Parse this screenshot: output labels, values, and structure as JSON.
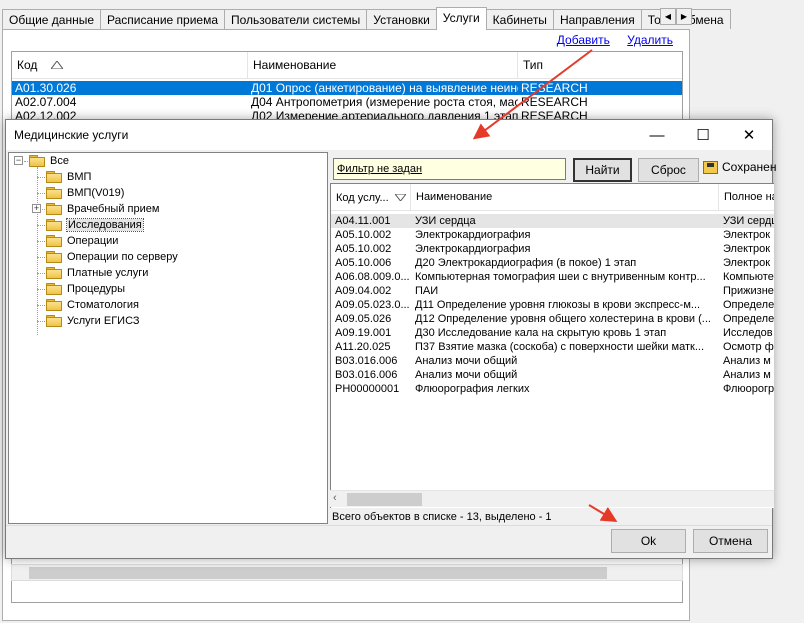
{
  "tabs": [
    {
      "label": "Общие данные",
      "active": false
    },
    {
      "label": "Расписание приема",
      "active": false
    },
    {
      "label": "Пользователи системы",
      "active": false
    },
    {
      "label": "Установки",
      "active": false
    },
    {
      "label": "Услуги",
      "active": true
    },
    {
      "label": "Кабинеты",
      "active": false
    },
    {
      "label": "Направления",
      "active": false
    },
    {
      "label": "Точки обмена",
      "active": false
    }
  ],
  "services_panel": {
    "add_link": "Добавить",
    "delete_link": "Удалить",
    "columns": {
      "code": "Код",
      "name": "Наименование",
      "type": "Тип"
    },
    "rows": [
      {
        "code": "A01.30.026",
        "name": "Д01 Опрос (анкетирование) на выявление неинф...",
        "type": "RESEARCH",
        "selected": true
      },
      {
        "code": "A02.07.004",
        "name": "Д04 Антропометрия (измерение роста стоя, мас...",
        "type": "RESEARCH",
        "selected": false
      },
      {
        "code": "A02.12.002",
        "name": "Д02 Измерение артериального давления 1 этап",
        "type": "RESEARCH",
        "selected": false
      }
    ]
  },
  "dialog": {
    "title": "Медицинские услуги",
    "window_buttons": {
      "minimize": "—",
      "maximize": "☐",
      "close": "✕"
    },
    "tree": {
      "root": "Все",
      "items": [
        {
          "label": "ВМП",
          "expandable": false,
          "selected": false
        },
        {
          "label": "ВМП(V019)",
          "expandable": false,
          "selected": false
        },
        {
          "label": "Врачебный прием",
          "expandable": true,
          "selected": false
        },
        {
          "label": "Исследования",
          "expandable": false,
          "selected": true
        },
        {
          "label": "Операции",
          "expandable": false,
          "selected": false
        },
        {
          "label": "Операции по серверу",
          "expandable": false,
          "selected": false
        },
        {
          "label": "Платные услуги",
          "expandable": false,
          "selected": false
        },
        {
          "label": "Процедуры",
          "expandable": false,
          "selected": false
        },
        {
          "label": "Стоматология",
          "expandable": false,
          "selected": false
        },
        {
          "label": "Услуги ЕГИСЗ",
          "expandable": false,
          "selected": false
        }
      ]
    },
    "filter_text": "Фильтр не задан",
    "find_button": "Найти",
    "reset_button": "Сброс",
    "save_button": "Сохранен",
    "columns": {
      "code": "Код услу...",
      "name": "Наименование",
      "full_name": "Полное на"
    },
    "rows": [
      {
        "code": "A04.11.001",
        "name": "УЗИ сердца",
        "full": "УЗИ сердц",
        "selected": true
      },
      {
        "code": "A05.10.002",
        "name": "Электрокардиография",
        "full": "Электрок",
        "selected": false
      },
      {
        "code": "A05.10.002",
        "name": "Электрокардиография",
        "full": "Электрок",
        "selected": false
      },
      {
        "code": "A05.10.006",
        "name": "Д20 Электрокардиография (в покое) 1 этап",
        "full": "Электрок",
        "selected": false
      },
      {
        "code": "A06.08.009.0...",
        "name": "Компьютерная томография шеи с внутривенным контр...",
        "full": "Компьюте",
        "selected": false
      },
      {
        "code": "A09.04.002",
        "name": "ПАИ",
        "full": "Прижизне",
        "selected": false
      },
      {
        "code": "A09.05.023.0...",
        "name": "Д11 Определение уровня глюкозы в крови экспресс-м...",
        "full": "Определе",
        "selected": false
      },
      {
        "code": "A09.05.026",
        "name": "Д12 Определение уровня общего холестерина в крови (...",
        "full": "Определе",
        "selected": false
      },
      {
        "code": "A09.19.001",
        "name": "Д30 Исследование кала на скрытую кровь  1 этап",
        "full": "Исследов",
        "selected": false
      },
      {
        "code": "A11.20.025",
        "name": "П37 Взятие мазка (соскоба) с поверхности шейки матк...",
        "full": "Осмотр ф",
        "selected": false
      },
      {
        "code": "B03.016.006",
        "name": "Анализ мочи общий",
        "full": "Анализ м",
        "selected": false
      },
      {
        "code": "B03.016.006",
        "name": "Анализ мочи общий",
        "full": "Анализ м",
        "selected": false
      },
      {
        "code": "PH00000001",
        "name": "Флюорография легких",
        "full": "Флюорогр",
        "selected": false
      }
    ],
    "status": "Всего объектов в списке - 13, выделено - 1",
    "ok_button": "Ok",
    "cancel_button": "Отмена"
  },
  "colors": {
    "selection": "#0078d7",
    "annotation_arrow": "#e53a2a",
    "filter_bg": "#ffffe1"
  }
}
